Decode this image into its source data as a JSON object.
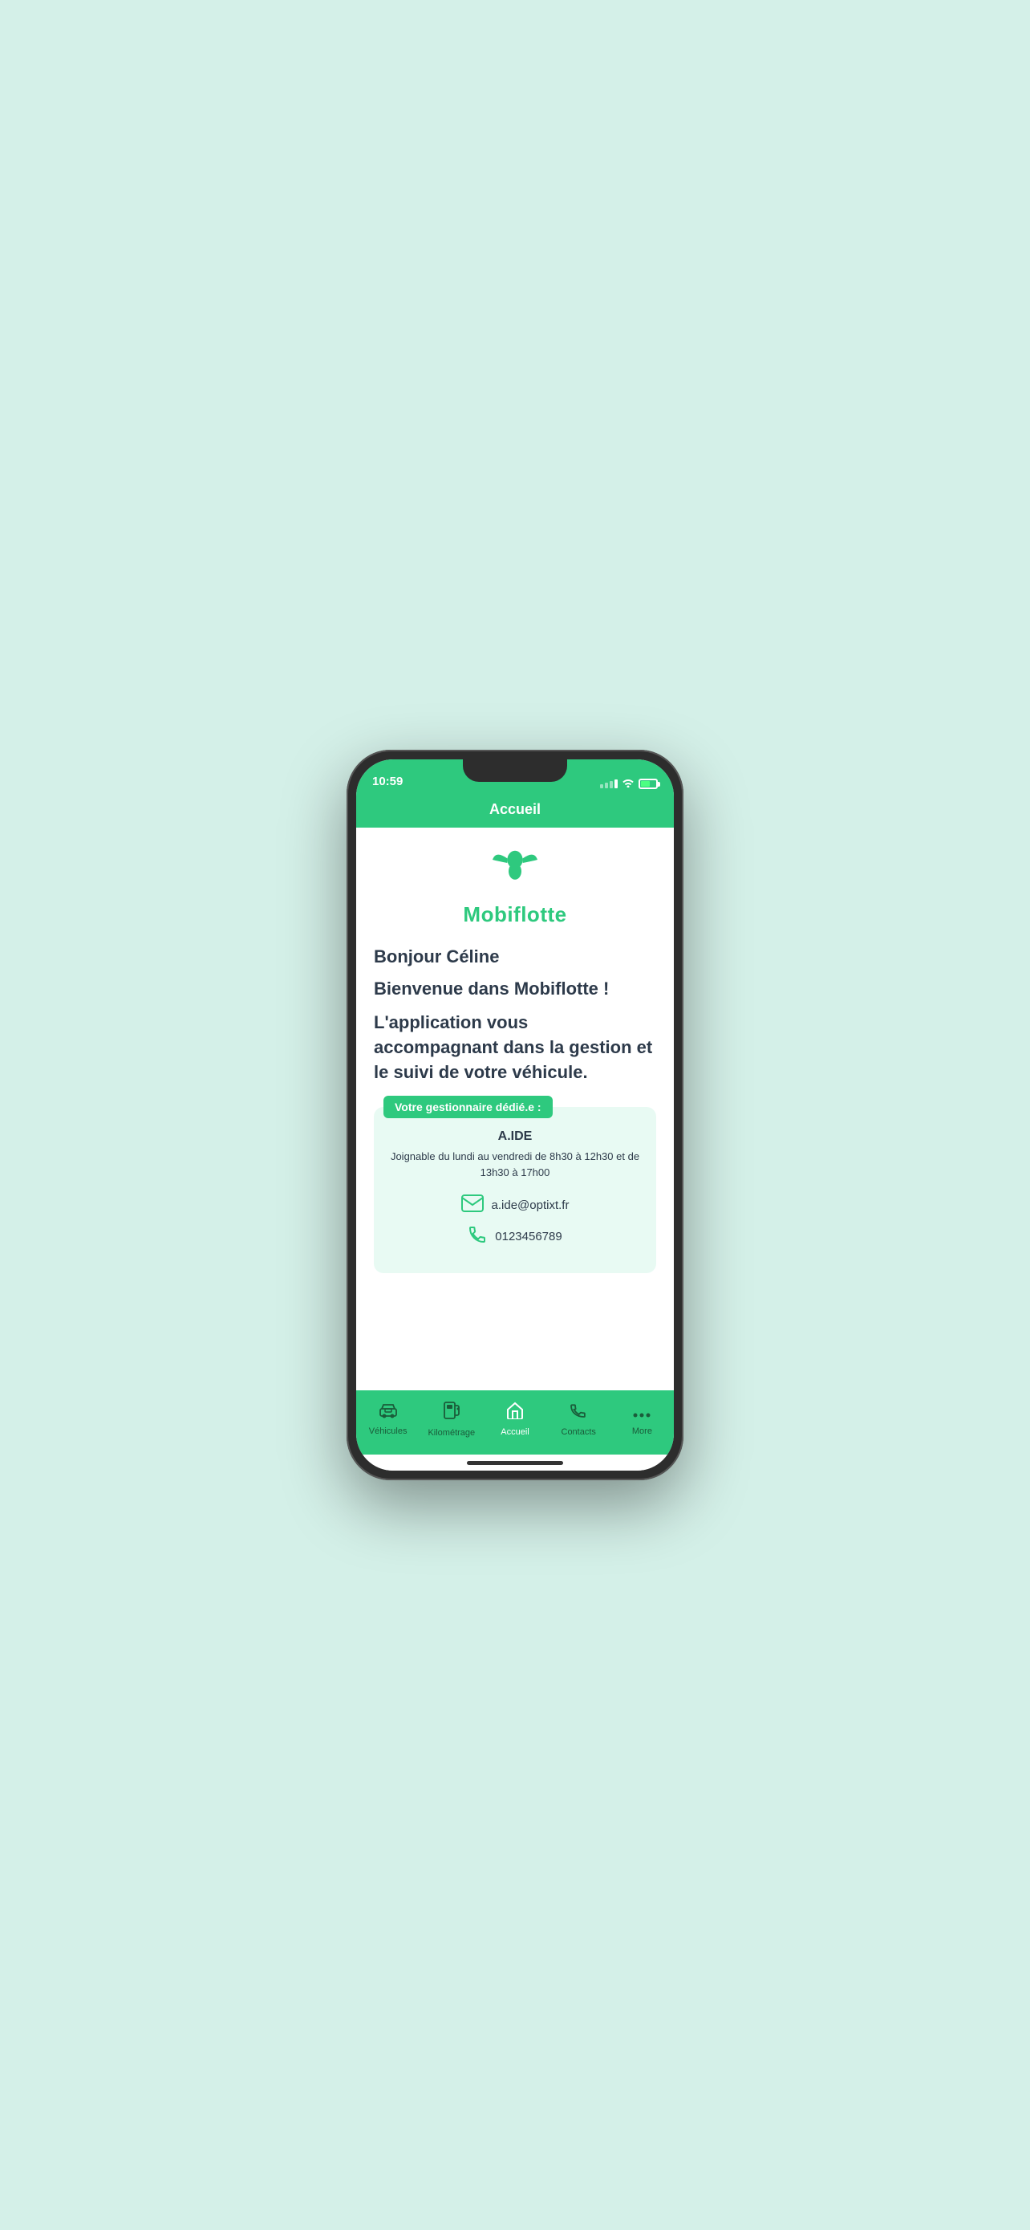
{
  "status": {
    "time": "10:59"
  },
  "header": {
    "title": "Accueil"
  },
  "logo": {
    "brand_name": "Mobiflotte"
  },
  "main": {
    "greeting": "Bonjour Céline",
    "welcome": "Bienvenue dans Mobiflotte !",
    "description": "L'application vous accompagnant dans la gestion et le suivi de votre véhicule.",
    "manager_badge": "Votre gestionnaire dédié.e :",
    "manager_name": "A.IDE",
    "manager_hours": "Joignable du lundi au vendredi de 8h30 à\n12h30 et de 13h30 à 17h00",
    "manager_email": "a.ide@optixt.fr",
    "manager_phone": "0123456789"
  },
  "nav": {
    "items": [
      {
        "label": "Véhicules",
        "icon": "car-icon",
        "active": false
      },
      {
        "label": "Kilométrage",
        "icon": "fuel-icon",
        "active": false
      },
      {
        "label": "Accueil",
        "icon": "home-icon",
        "active": true
      },
      {
        "label": "Contacts",
        "icon": "phone-icon",
        "active": false
      },
      {
        "label": "More",
        "icon": "more-icon",
        "active": false
      }
    ]
  },
  "colors": {
    "brand_green": "#2ec97e",
    "text_dark": "#2d3a4a",
    "card_bg": "#e8faf3"
  }
}
